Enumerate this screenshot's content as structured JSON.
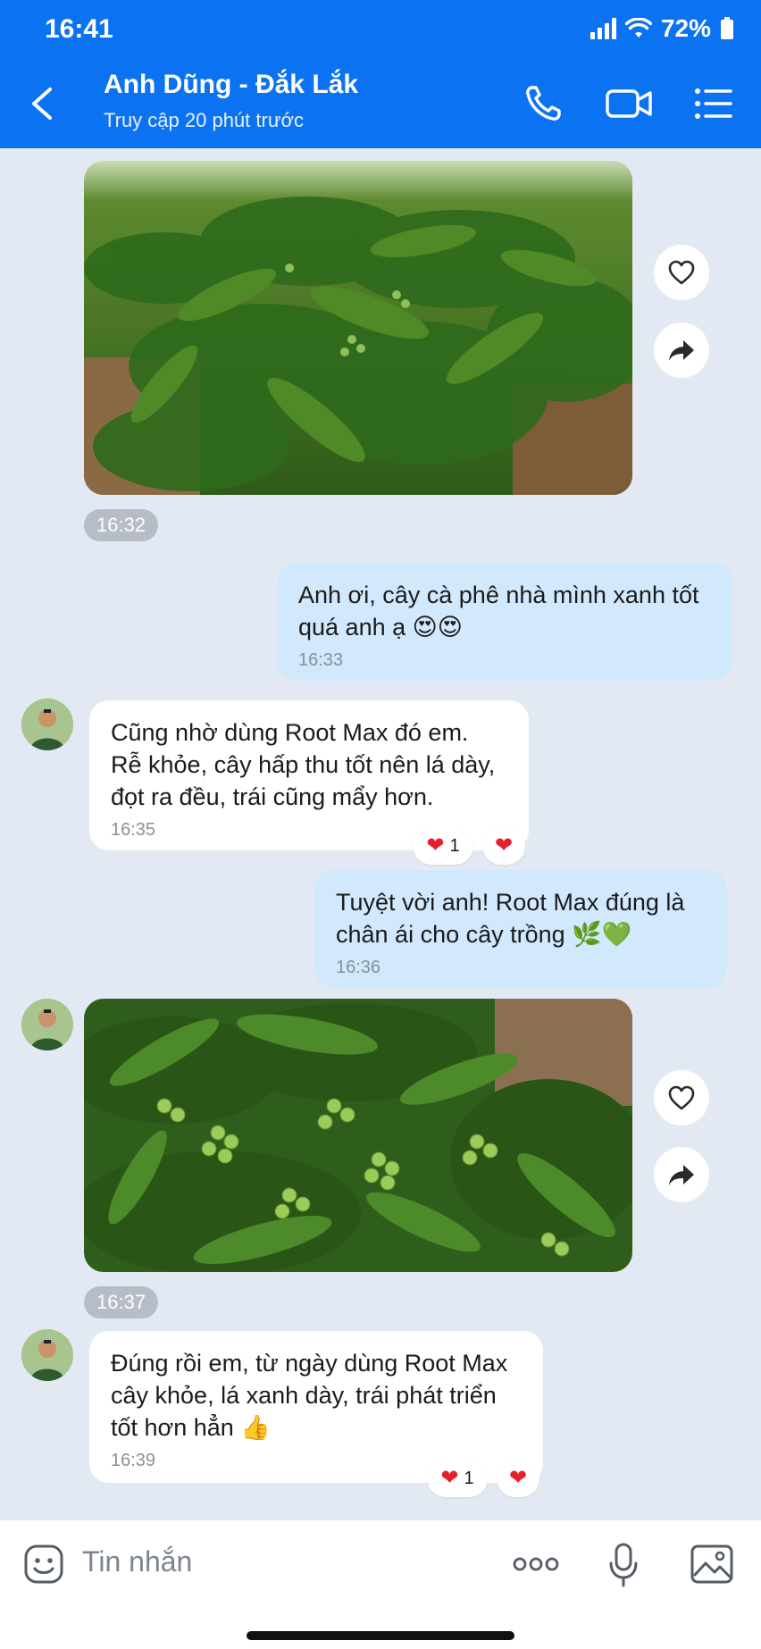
{
  "status_bar": {
    "time": "16:41",
    "battery": "72%"
  },
  "header": {
    "contact_name": "Anh Dũng - Đắk Lắk",
    "last_seen": "Truy cập 20 phút trước",
    "icons": [
      "back-icon",
      "phone-icon",
      "video-call-icon",
      "menu-list-icon"
    ],
    "bg_color": "#0b73f2"
  },
  "messages": [
    {
      "type": "image",
      "side": "in",
      "time": "16:32",
      "subject": "coffee-tree-photo"
    },
    {
      "type": "text",
      "side": "out",
      "line1": "Anh ơi, cây cà phê nhà mình xanh tốt",
      "line2": "quá anh ạ",
      "emoji": "😍😍",
      "time": "16:33"
    },
    {
      "type": "text",
      "side": "in",
      "line1": "Cũng nhờ dùng Root Max đó em.",
      "line2": "Rễ khỏe, cây hấp thu tốt nên lá dày,",
      "line3": "đọt ra đều, trái cũng mẩy hơn.",
      "time": "16:35",
      "reaction_count": "1"
    },
    {
      "type": "text",
      "side": "out",
      "line1": "Tuyệt vời anh! Root Max đúng là",
      "line2": "chân ái cho cây trồng",
      "emoji": "🌿💚",
      "time": "16:36"
    },
    {
      "type": "image",
      "side": "in",
      "time": "16:37",
      "subject": "coffee-cherries-photo"
    },
    {
      "type": "text",
      "side": "in",
      "line1": "Đúng rồi em, từ ngày dùng Root Max",
      "line2": "cây khỏe, lá xanh dày, trái phát triển",
      "line3": "tốt hơn hẳn",
      "emoji": "👍",
      "time": "16:39",
      "reaction_count": "1"
    }
  ],
  "composer": {
    "placeholder": "Tin nhắn",
    "icons": [
      "sticker-icon",
      "more-dots-icon",
      "microphone-icon",
      "gallery-icon"
    ]
  }
}
